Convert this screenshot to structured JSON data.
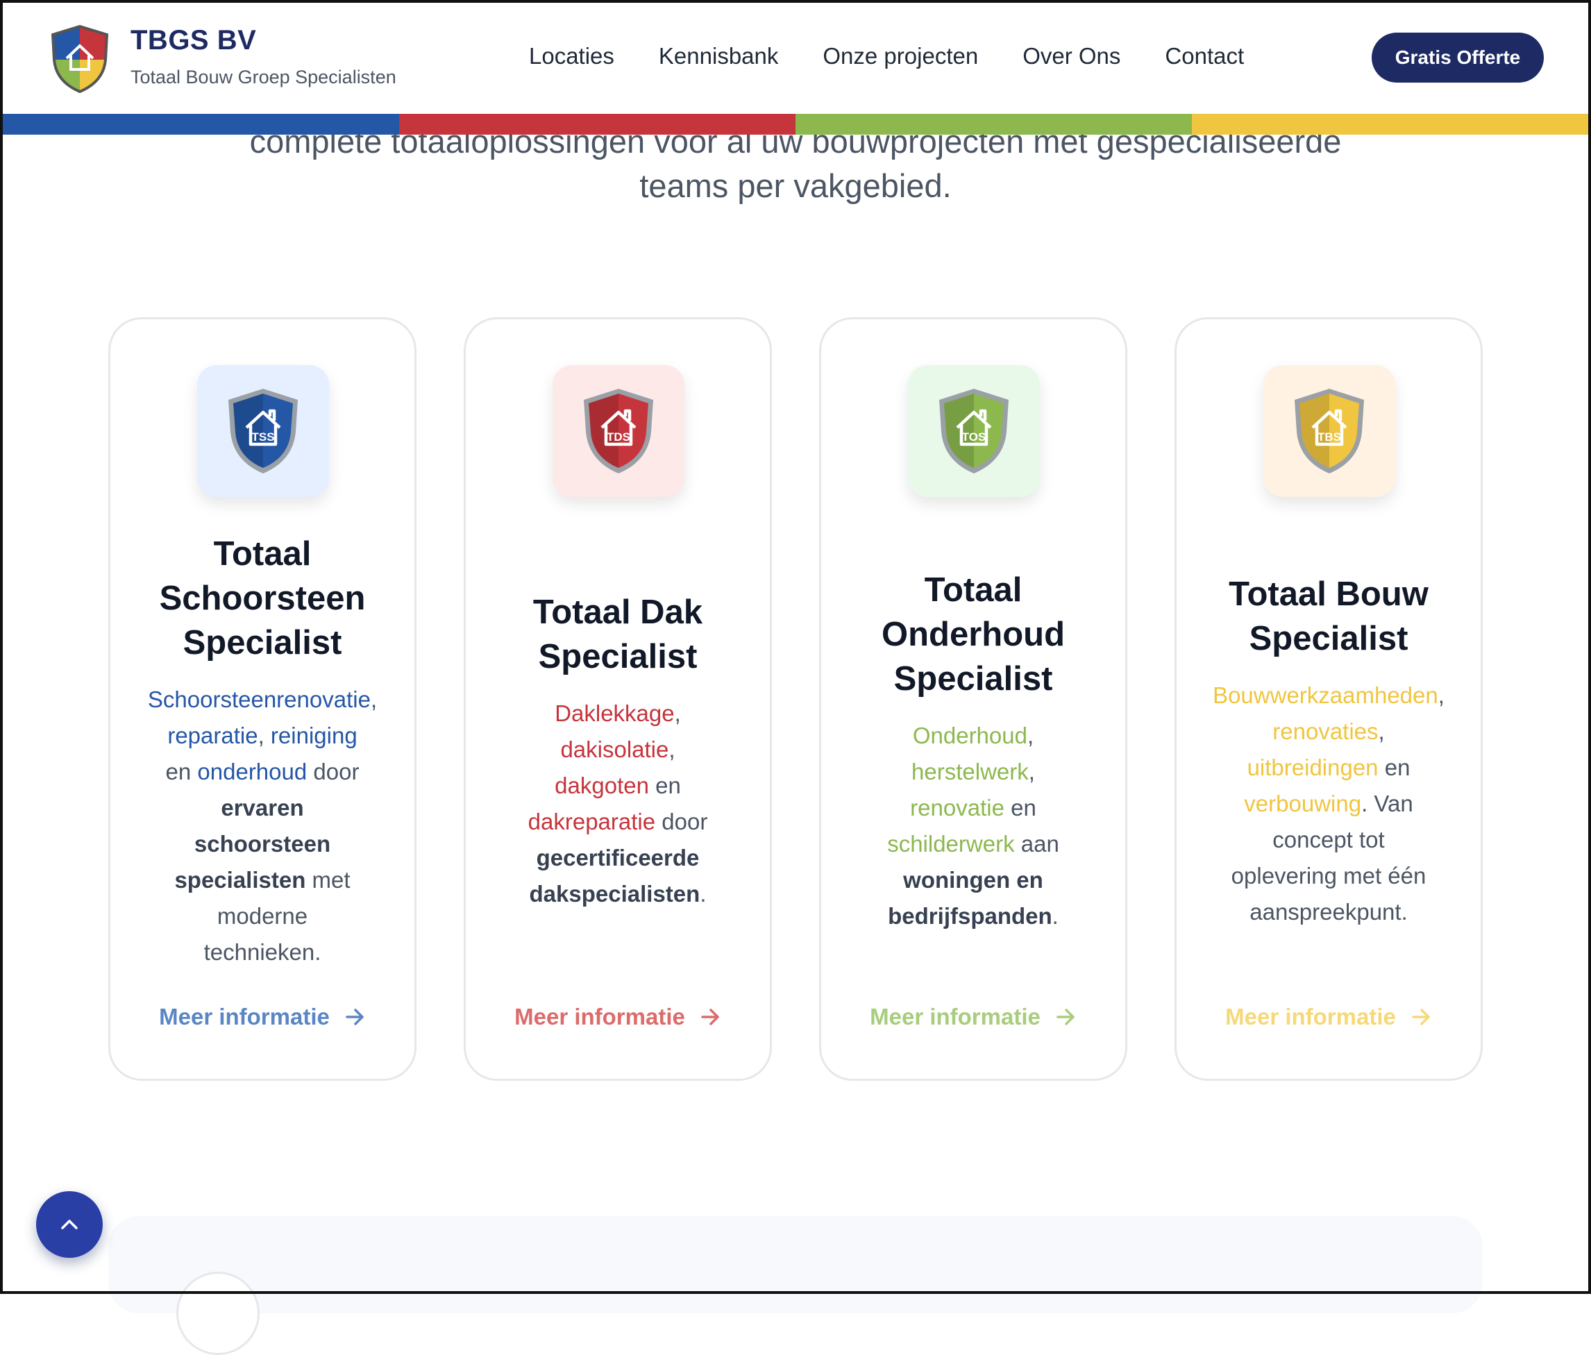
{
  "brand": {
    "name": "TBGS BV",
    "subtitle": "Totaal Bouw Groep Specialisten"
  },
  "nav": [
    "Locaties",
    "Kennisbank",
    "Onze projecten",
    "Over Ons",
    "Contact"
  ],
  "cta_label": "Gratis Offerte",
  "stripe_colors": [
    "#2457a6",
    "#c6343c",
    "#8cb84e",
    "#f0c53f"
  ],
  "intro": {
    "line1": "complete totaaloplossingen voor al uw bouwprojecten met gespecialiseerde",
    "line2": "teams per vakgebied."
  },
  "cards": [
    {
      "title": [
        "Totaal",
        "Schoorsteen",
        "Specialist"
      ],
      "badge": "TSS",
      "accent": "#2457a6",
      "link_color": "#5a86c5",
      "icon_bg": "#e6efff",
      "description_html": "<span class=\"hl\">Schoorsteenrenovatie</span>, <span class=\"hl\">reparatie</span>, <span class=\"hl\">reiniging</span><br>en <span class=\"hl\">onderhoud</span> door<br><b>ervaren</b><br><b>schoorsteen</b><br><b>specialisten</b> met<br>moderne<br>technieken.",
      "link": "Meer informatie"
    },
    {
      "title": [
        "Totaal Dak",
        "Specialist"
      ],
      "badge": "TDS",
      "accent": "#c6343c",
      "link_color": "#dd6b6b",
      "icon_bg": "#fde9e8",
      "description_html": "<span class=\"hl\">Daklekkage</span>,<br><span class=\"hl\">dakisolatie</span>,<br><span class=\"hl\">dakgoten</span> en<br><span class=\"hl\">dakreparatie</span> door<br><b>gecertificeerde</b><br><b>dakspecialisten</b>.",
      "link": "Meer informatie"
    },
    {
      "title": [
        "Totaal",
        "Onderhoud",
        "Specialist"
      ],
      "badge": "TOS",
      "accent": "#8cb84e",
      "link_color": "#a8cd7c",
      "icon_bg": "#e8f9ea",
      "description_html": "<span class=\"hl\">Onderhoud</span>,<br><span class=\"hl\">herstelwerk</span>,<br><span class=\"hl\">renovatie</span> en<br><span class=\"hl\">schilderwerk</span> aan<br><b>woningen en</b><br><b>bedrijfspanden</b>.",
      "link": "Meer informatie"
    },
    {
      "title": [
        "Totaal Bouw",
        "Specialist"
      ],
      "badge": "TBS",
      "accent": "#f0c53f",
      "link_color": "#f5d978",
      "icon_bg": "#fff2e2",
      "description_html": "<span class=\"hl\">Bouwwerkzaamheden</span>,<br><span class=\"hl\">renovaties</span>,<br><span class=\"hl\">uitbreidingen</span> en<br><span class=\"hl\">verbouwing</span>. Van<br>concept tot<br>oplevering met één<br>aanspreekpunt.",
      "link": "Meer informatie"
    }
  ]
}
